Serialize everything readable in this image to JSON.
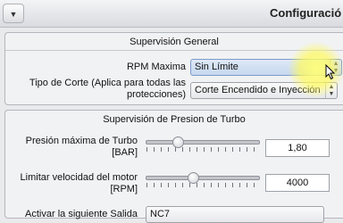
{
  "window": {
    "title": "Configuració"
  },
  "general": {
    "heading": "Supervisión General",
    "rpm_label": "RPM Maxima",
    "rpm_value": "Sin Límite",
    "cut_label": "Tipo de Corte (Aplica para todas las protecciones)",
    "cut_value": "Corte Encendido e Inyección"
  },
  "turbo": {
    "heading": "Supervisión de Presion de Turbo",
    "pressure_label": "Presión máxima de Turbo [BAR]",
    "pressure_value": "1,80",
    "pressure_level": 0.26,
    "speed_label": "Limitar velocidad del motor [RPM]",
    "speed_value": "4000",
    "speed_level": 0.41,
    "output_label": "Activar la siguiente Salida",
    "output_value": "NC7"
  },
  "colors": {
    "accent_highlight": "#fff86a",
    "selected_combo": "#c6d7ef"
  },
  "icons": {
    "menu": "chevron-down-icon",
    "cursor": "mouse-pointer-icon"
  }
}
